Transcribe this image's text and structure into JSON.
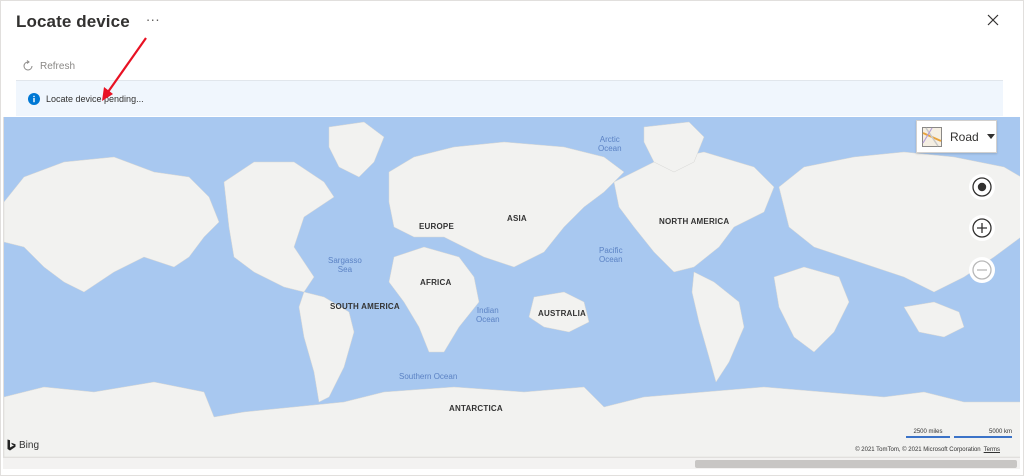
{
  "panel": {
    "title": "Locate device",
    "more_label": "···"
  },
  "toolbar": {
    "refresh_label": "Refresh"
  },
  "banner": {
    "message": "Locate device pending..."
  },
  "map": {
    "style_label": "Road",
    "continents": [
      "EUROPE",
      "ASIA",
      "NORTH AMERICA",
      "AFRICA",
      "SOUTH AMERICA",
      "AUSTRALIA",
      "ANTARCTICA"
    ],
    "waters": {
      "arctic": [
        "Arctic",
        "Ocean"
      ],
      "pacific": [
        "Pacific",
        "Ocean"
      ],
      "sargasso": [
        "Sargasso",
        "Sea"
      ],
      "indian": [
        "Indian",
        "Ocean"
      ],
      "southern": "Southern Ocean"
    },
    "bing_label": "Bing",
    "scale_miles": "2500 miles",
    "scale_km": "5000 km",
    "copyright": "© 2021 TomTom, © 2021 Microsoft Corporation",
    "terms": "Terms"
  },
  "colors": {
    "water": "#a8c8f0",
    "land": "#f2f2f0",
    "accent": "#0078d4",
    "annotation_arrow": "#e81123"
  }
}
